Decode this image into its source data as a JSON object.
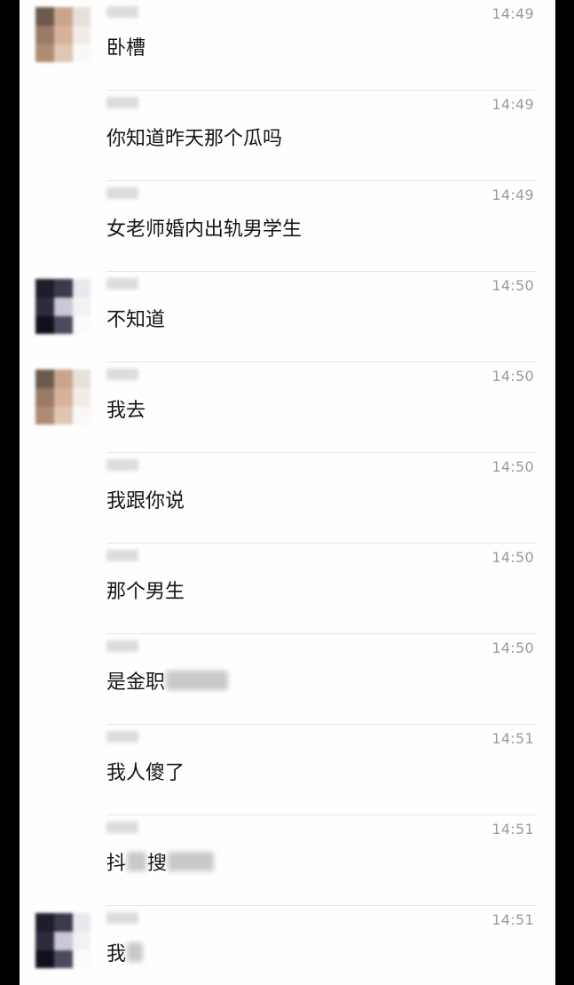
{
  "messages": [
    {
      "time": "14:49",
      "avatar": "a",
      "parts": [
        {
          "t": "卧槽"
        }
      ]
    },
    {
      "time": "14:49",
      "avatar": null,
      "parts": [
        {
          "t": "你知道昨天那个瓜吗"
        }
      ]
    },
    {
      "time": "14:49",
      "avatar": null,
      "parts": [
        {
          "t": "女老师婚内出轨男学生"
        }
      ]
    },
    {
      "time": "14:50",
      "avatar": "b",
      "parts": [
        {
          "t": "不知道"
        }
      ]
    },
    {
      "time": "14:50",
      "avatar": "a",
      "parts": [
        {
          "t": "我去"
        }
      ]
    },
    {
      "time": "14:50",
      "avatar": null,
      "parts": [
        {
          "t": "我跟你说"
        }
      ]
    },
    {
      "time": "14:50",
      "avatar": null,
      "parts": [
        {
          "t": "那个男生"
        }
      ]
    },
    {
      "time": "14:50",
      "avatar": null,
      "parts": [
        {
          "t": "是金职"
        },
        {
          "blur": 70
        }
      ]
    },
    {
      "time": "14:51",
      "avatar": null,
      "parts": [
        {
          "t": "我人傻了"
        }
      ]
    },
    {
      "time": "14:51",
      "avatar": null,
      "parts": [
        {
          "t": "抖"
        },
        {
          "blur": 22
        },
        {
          "t": "搜"
        },
        {
          "blur": 52
        }
      ]
    },
    {
      "time": "14:51",
      "avatar": "b",
      "parts": [
        {
          "t": "我"
        },
        {
          "blur": 18
        }
      ]
    }
  ],
  "avatar_palettes": {
    "a": [
      "#6b5a4c",
      "#c9a48d",
      "#e7e1dc",
      "#9b7b66",
      "#d6b29a",
      "#f1ece8",
      "#b08c74",
      "#e0c6b4",
      "#faf8f6"
    ],
    "b": [
      "#1d1d2b",
      "#3a3a4d",
      "#e8e8ee",
      "#2c2c3e",
      "#c9c9d3",
      "#f2f2f5",
      "#10101c",
      "#4b4b60",
      "#fbfbfd"
    ]
  }
}
